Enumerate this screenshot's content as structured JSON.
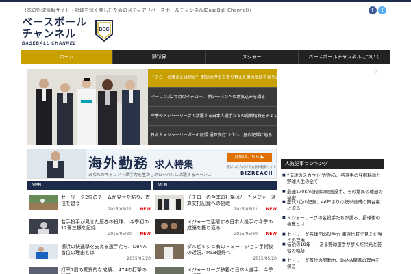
{
  "header": {
    "tagline": "日本の野球情報サイト・野球を深く楽しむためのメディア「ベースボールチャンネル(BaseBall Channel)」",
    "social": {
      "facebook_glyph": "f",
      "twitter_glyph": "t"
    }
  },
  "logo": {
    "jp_line1": "ベースボール",
    "jp_line2": "チャンネル",
    "en": "BASEBALL CHANNEL",
    "emblem_text": "BBC",
    "brand_color": "#1d2b4a",
    "gold": "#c8a000"
  },
  "nav": {
    "items": [
      {
        "label": "ホーム",
        "active": true
      },
      {
        "label": "野球界",
        "active": false
      },
      {
        "label": "メジャー",
        "active": false
      },
      {
        "label": "ベースボールチャンネルについて",
        "active": false
      }
    ]
  },
  "hero": {
    "rows": [
      {
        "text": "イチローの凄さとは何か？ 野球の歴史を塗り替えた男の軌跡を振り返る特集記事",
        "active": true
      },
      {
        "text": "マーリンズ2年目のイチロー、 新シーズンへの意気込みを語る",
        "active": false
      },
      {
        "text": "今季のメジャーリーグで活躍する日本人選手たちの最新情報をチェック",
        "active": false
      },
      {
        "text": "日本人メジャーリーガーの記録 通算安打12位へ、歴代記録に迫る",
        "active": false
      }
    ]
  },
  "ad": {
    "marker": "i ▷",
    "title": "海外勤務",
    "title_suffix": "求人特集",
    "subtitle": "あなたのキャリア・語学力を生かしグローバルに活躍するチャンス",
    "button": "詳細はこちら ▶",
    "note": "選ばれた人だけの会員制転職サイト",
    "brand": "BIZREACH"
  },
  "sections": {
    "npb": {
      "label": "NPB",
      "items": [
        {
          "title": "セ・リーグ2位のチームが見せた粘り、首位を追う",
          "date": "2015/05/21",
          "is_new": true,
          "new_label": "NEW"
        },
        {
          "title": "若手投手が見せた圧巻の投球、 今季初の12奪三振を記録",
          "date": "2015/05/20",
          "is_new": true,
          "new_label": "NEW"
        },
        {
          "title": "横浜の快進撃を支える選手たち、DeNA首位の理由とは",
          "date": "2015/05/20",
          "is_new": false,
          "new_label": ""
        },
        {
          "title": "打率7割の驚異的な成績、.474の打撃の秘密",
          "date": "",
          "is_new": false,
          "new_label": ""
        }
      ]
    },
    "mlb": {
      "label": "MLB",
      "items": [
        {
          "title": "イチローの今季の打撃は？ !? メジャー通算安打記録への挑戦",
          "date": "2015/05/21",
          "is_new": true,
          "new_label": "NEW"
        },
        {
          "title": "メジャーで活躍する日本人投手の今季の成績を振り返る",
          "date": "2015/05/20",
          "is_new": true,
          "new_label": "NEW"
        },
        {
          "title": "ダルビッシュ有のトミー・ジョン手術後の近況、MLB復帰へ",
          "date": "2015/05/20",
          "is_new": false,
          "new_label": ""
        },
        {
          "title": "メジャーリーグ移籍の日本人選手、今季の通算40",
          "date": "",
          "is_new": false,
          "new_label": ""
        }
      ]
    }
  },
  "sidebar": {
    "title": "人気記事ランキング",
    "items": [
      "“伝説のスカウト”が語る、名選手の発掘秘話と野球人生の全て",
      "最速170Km計測の剛腕投手、その驚異の球速の秘密",
      "歴代1位の記録、46年ぶりの快挙達成の舞台裏に迫る",
      "メジャーリーグの名投手たちが語る、投球術の極意とは",
      "セ・リーグ各球団の投手力 徹底比較で見えた強さの理由",
      "伝説の19年——ある野球選手が歩んだ栄光と苦悩の軌跡",
      "セ・リーグ首位の原動力、DeNA躍進の理由を探る"
    ]
  }
}
